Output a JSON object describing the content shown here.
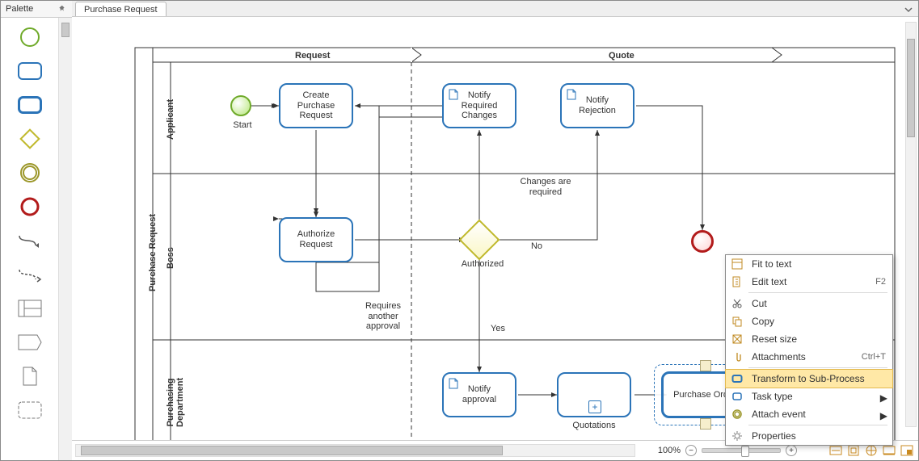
{
  "palette": {
    "title": "Palette"
  },
  "tab": {
    "title": "Purchase Request"
  },
  "pool": {
    "title": "Purchase Request"
  },
  "phases": {
    "request": "Request",
    "quote": "Quote"
  },
  "lanes": {
    "applicant": "Applicant",
    "boss": "Boss",
    "purchasing": "Purchasing\nDepartment"
  },
  "tasks": {
    "create": "Create\nPurchase\nRequest",
    "notify_changes": "Notify\nRequired\nChanges",
    "notify_reject": "Notify\nRejection",
    "authorize": "Authorize\nRequest",
    "notify_approval": "Notify\napproval",
    "purchase_order": "Purchase Order",
    "quotations": "Quotations"
  },
  "labels": {
    "start": "Start",
    "changes": "Changes are\nrequired",
    "no": "No",
    "authorized": "Authorized",
    "requires": "Requires\nanother\napproval",
    "yes": "Yes"
  },
  "zoom": {
    "value": "100%"
  },
  "context": {
    "items": [
      {
        "icon": "fit",
        "label": "Fit to text",
        "shortcut": "",
        "submenu": false
      },
      {
        "icon": "edit",
        "label": "Edit text",
        "shortcut": "F2",
        "submenu": false
      },
      {
        "icon": "cut",
        "label": "Cut",
        "shortcut": "",
        "submenu": false
      },
      {
        "icon": "copy",
        "label": "Copy",
        "shortcut": "",
        "submenu": false
      },
      {
        "icon": "reset",
        "label": "Reset size",
        "shortcut": "",
        "submenu": false
      },
      {
        "icon": "attach",
        "label": "Attachments",
        "shortcut": "Ctrl+T",
        "submenu": false
      },
      {
        "icon": "subproc",
        "label": "Transform to Sub-Process",
        "shortcut": "",
        "submenu": false,
        "highlight": true
      },
      {
        "icon": "tasktype",
        "label": "Task type",
        "shortcut": "",
        "submenu": true
      },
      {
        "icon": "attachev",
        "label": "Attach event",
        "shortcut": "",
        "submenu": true
      },
      {
        "icon": "props",
        "label": "Properties",
        "shortcut": "",
        "submenu": false
      }
    ]
  },
  "chart_data": {
    "type": "bpmn_process",
    "pool": "Purchase Request",
    "phases": [
      "Request",
      "Quote"
    ],
    "lanes": [
      "Applicant",
      "Boss",
      "Purchasing Department"
    ],
    "nodes": [
      {
        "id": "start",
        "type": "startEvent",
        "lane": "Applicant",
        "phase": "Request",
        "label": "Start"
      },
      {
        "id": "create",
        "type": "task",
        "lane": "Applicant",
        "phase": "Request",
        "label": "Create Purchase Request"
      },
      {
        "id": "nchg",
        "type": "task",
        "subtype": "script",
        "lane": "Applicant",
        "phase": "Quote",
        "label": "Notify Required Changes"
      },
      {
        "id": "nrej",
        "type": "task",
        "subtype": "script",
        "lane": "Applicant",
        "phase": "Quote",
        "label": "Notify Rejection"
      },
      {
        "id": "auth",
        "type": "task",
        "lane": "Boss",
        "phase": "Request",
        "label": "Authorize Request"
      },
      {
        "id": "gw",
        "type": "exclusiveGateway",
        "lane": "Boss",
        "phase": "Quote",
        "label": "Authorized"
      },
      {
        "id": "end",
        "type": "endEvent",
        "lane": "Boss",
        "phase": "Quote"
      },
      {
        "id": "napp",
        "type": "task",
        "subtype": "script",
        "lane": "Purchasing Department",
        "phase": "Quote",
        "label": "Notify approval"
      },
      {
        "id": "sub",
        "type": "collapsedSubProcess",
        "lane": "Purchasing Department",
        "phase": "Quote",
        "label": "Quotations"
      },
      {
        "id": "po",
        "type": "callActivity",
        "lane": "Purchasing Department",
        "phase": "Quote",
        "label": "Purchase Order",
        "selected": true
      }
    ],
    "flows": [
      {
        "from": "start",
        "to": "create"
      },
      {
        "from": "create",
        "to": "auth"
      },
      {
        "from": "auth",
        "to": "gw"
      },
      {
        "from": "gw",
        "to": "nchg",
        "label": "Changes are required"
      },
      {
        "from": "nchg",
        "to": "create",
        "label": "Requires another approval"
      },
      {
        "from": "gw",
        "to": "nrej",
        "label": "No"
      },
      {
        "from": "nrej",
        "to": "end"
      },
      {
        "from": "gw",
        "to": "napp",
        "label": "Yes"
      },
      {
        "from": "napp",
        "to": "sub"
      },
      {
        "from": "sub",
        "to": "po"
      }
    ]
  }
}
